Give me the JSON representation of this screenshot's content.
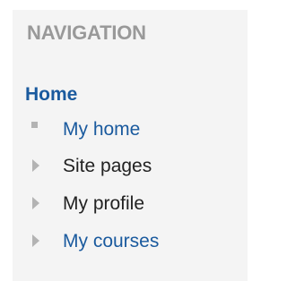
{
  "block": {
    "title": "NAVIGATION",
    "home_label": "Home",
    "items": [
      {
        "label": "My home",
        "icon": "square-bullet-icon",
        "is_link": true
      },
      {
        "label": "Site pages",
        "icon": "expand-arrow-icon",
        "is_link": false
      },
      {
        "label": "My profile",
        "icon": "expand-arrow-icon",
        "is_link": false
      },
      {
        "label": "My courses",
        "icon": "expand-arrow-icon",
        "is_link": true
      }
    ]
  },
  "colors": {
    "panel_background": "#f4f4f4",
    "title": "#999999",
    "link": "#1a5a9e",
    "text": "#222222",
    "icon": "#b3b3b3"
  }
}
